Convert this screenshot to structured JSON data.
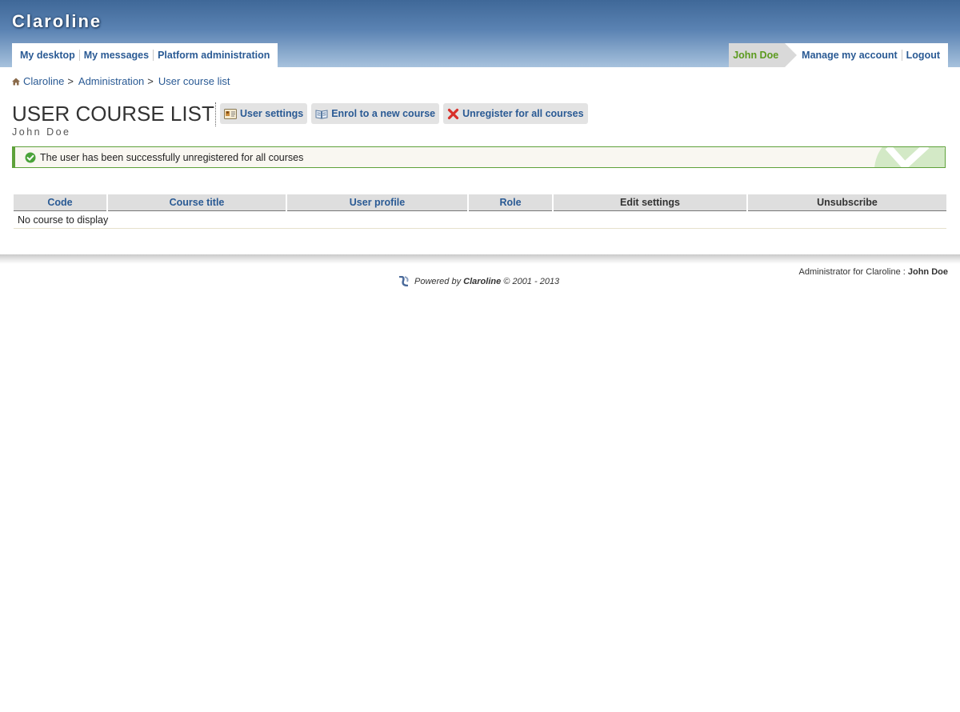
{
  "header": {
    "logo": "Claroline",
    "nav_left": [
      "My desktop",
      "My messages",
      "Platform administration"
    ],
    "user_name": "John Doe",
    "nav_right": [
      "Manage my account",
      "Logout"
    ]
  },
  "breadcrumb": {
    "items": [
      "Claroline",
      "Administration",
      "User course list"
    ],
    "separator": ">"
  },
  "page": {
    "title": "USER COURSE LIST",
    "subtitle": "John Doe"
  },
  "actions": {
    "user_settings": "User settings",
    "enrol": "Enrol to a new course",
    "unregister_all": "Unregister for all courses"
  },
  "message": {
    "text": "The user has been successfully unregistered for all courses",
    "color": "#5ea13a"
  },
  "table": {
    "headers": [
      "Code",
      "Course title",
      "User profile",
      "Role",
      "Edit settings",
      "Unsubscribe"
    ],
    "empty_text": "No course to display"
  },
  "footer": {
    "admin_label": "Administrator for Claroline :",
    "admin_name": "John Doe",
    "powered_prefix": "Powered by",
    "powered_brand": "Claroline",
    "powered_suffix": "© 2001 - 2013"
  },
  "colors": {
    "link": "#2a5a94",
    "user_accent": "#5b9a1e",
    "banner": "#3f6898"
  }
}
